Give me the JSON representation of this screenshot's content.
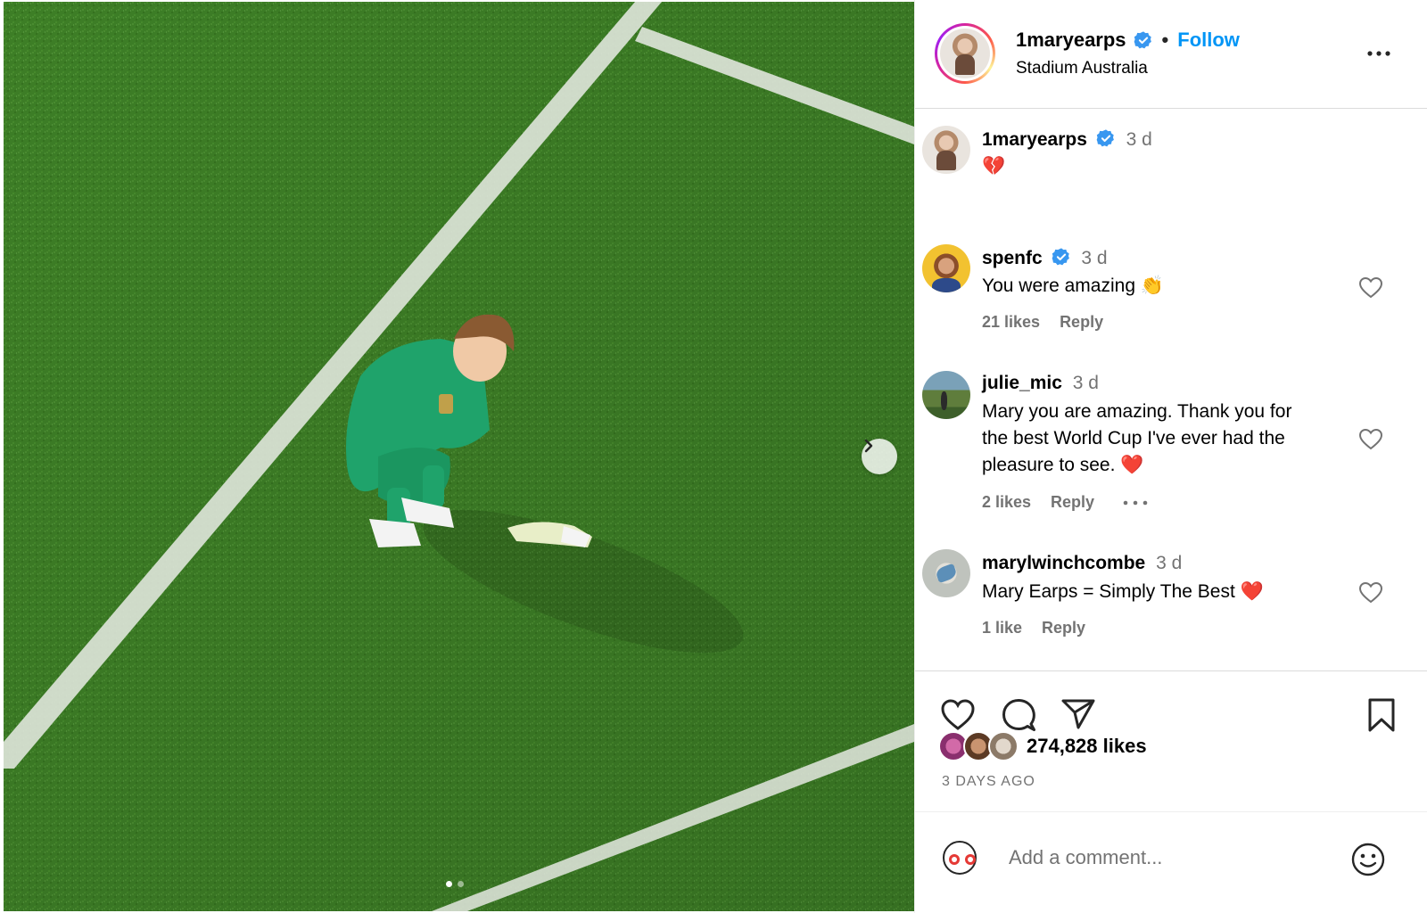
{
  "post": {
    "image_alt": "",
    "carousel": {
      "total": 2,
      "active": 1
    }
  },
  "header": {
    "username": "1maryearps",
    "separator": "•",
    "follow_label": "Follow",
    "location": "Stadium Australia"
  },
  "caption": {
    "username": "1maryearps",
    "time": "3 d",
    "text": "💔"
  },
  "comments": [
    {
      "username": "spenfc",
      "verified": true,
      "time": "3 d",
      "text": "You were amazing 👏",
      "likes": "21 likes",
      "reply": "Reply"
    },
    {
      "username": "julie_mic",
      "verified": false,
      "time": "3 d",
      "text_lines": [
        "Mary you are amazing. Thank you for",
        "the best World Cup I've ever had the",
        "pleasure to see. ❤️"
      ],
      "likes": "2 likes",
      "reply": "Reply"
    },
    {
      "username": "marylwinchcombe",
      "verified": false,
      "time": "3 d",
      "text": "Mary Earps = Simply The Best ❤️",
      "likes": "1 like",
      "reply": "Reply"
    }
  ],
  "engagement": {
    "likes": "274,828 likes",
    "date": "3 DAYS AGO"
  },
  "add_comment": {
    "placeholder": "Add a comment..."
  },
  "colors": {
    "follow_blue": "#0095f6",
    "verified_blue": "#3897f0",
    "muted": "#737373",
    "grass": "#3f7f28"
  },
  "icons": [
    "chevron-right-icon",
    "more-icon",
    "verified-icon",
    "heart-icon",
    "comment-icon",
    "share-icon",
    "bookmark-icon",
    "emoji-icon"
  ]
}
